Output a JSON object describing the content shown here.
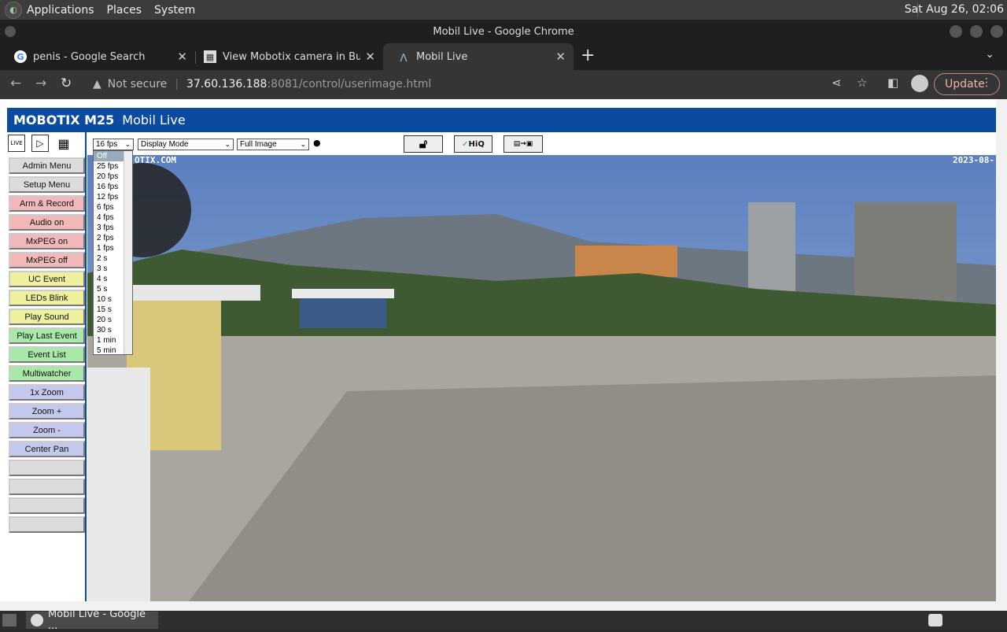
{
  "topbar": {
    "menus": [
      "Applications",
      "Places",
      "System"
    ],
    "clock": "Sat Aug 26, 02:06"
  },
  "window": {
    "title": "Mobil Live - Google Chrome"
  },
  "tabs": [
    {
      "title": "penis - Google Search",
      "icon": "google-g-icon"
    },
    {
      "title": "View Mobotix camera in Bulga",
      "icon": "camera-site-icon"
    },
    {
      "title": "Mobil Live",
      "icon": "mobotix-icon"
    }
  ],
  "address": {
    "security": "Not secure",
    "host": "37.60.136.188",
    "path": ":8081/control/userimage.html",
    "update_label": "Update"
  },
  "mobotix": {
    "brand": "MOBOTIX M25",
    "title": "Mobil Live",
    "buttons": [
      {
        "label": "Admin Menu",
        "color": "#dcdcdc"
      },
      {
        "label": "Setup Menu",
        "color": "#dcdcdc"
      },
      {
        "label": "Arm & Record",
        "color": "#f0b8b8"
      },
      {
        "label": "Audio on",
        "color": "#f0b8b8"
      },
      {
        "label": "MxPEG on",
        "color": "#f0b8b8"
      },
      {
        "label": "MxPEG off",
        "color": "#f0b8b8"
      },
      {
        "label": "UC Event",
        "color": "#eef0a0"
      },
      {
        "label": "LEDs Blink",
        "color": "#eef0a0"
      },
      {
        "label": "Play Sound",
        "color": "#eef0a0"
      },
      {
        "label": "Play Last Event",
        "color": "#a8e8a8"
      },
      {
        "label": "Event List",
        "color": "#a8e8a8"
      },
      {
        "label": "Multiwatcher",
        "color": "#a8e8a8"
      },
      {
        "label": "1x Zoom",
        "color": "#c4c8ec"
      },
      {
        "label": "Zoom +",
        "color": "#c4c8ec"
      },
      {
        "label": "Zoom -",
        "color": "#c4c8ec"
      },
      {
        "label": "Center Pan",
        "color": "#c4c8ec"
      },
      {
        "label": "",
        "color": "#dcdcdc"
      },
      {
        "label": "",
        "color": "#dcdcdc"
      },
      {
        "label": "",
        "color": "#dcdcdc"
      },
      {
        "label": "",
        "color": "#dcdcdc"
      }
    ],
    "fps_select": "16 fps",
    "display_mode": "Display Mode",
    "image_mode": "Full Image",
    "hiq_label": "HiQ",
    "fps_options": [
      "Off",
      "25 fps",
      "20 fps",
      "16 fps",
      "12 fps",
      "6 fps",
      "4 fps",
      "3 fps",
      "2 fps",
      "1 fps",
      "2 s",
      "3 s",
      "4 s",
      "5 s",
      "10 s",
      "15 s",
      "20 s",
      "30 s",
      "1 min",
      "5 min"
    ],
    "overlay_left": "OTIX.COM",
    "overlay_right": "2023-08-"
  },
  "taskbar": {
    "task_label": "Mobil Live - Google ..."
  }
}
